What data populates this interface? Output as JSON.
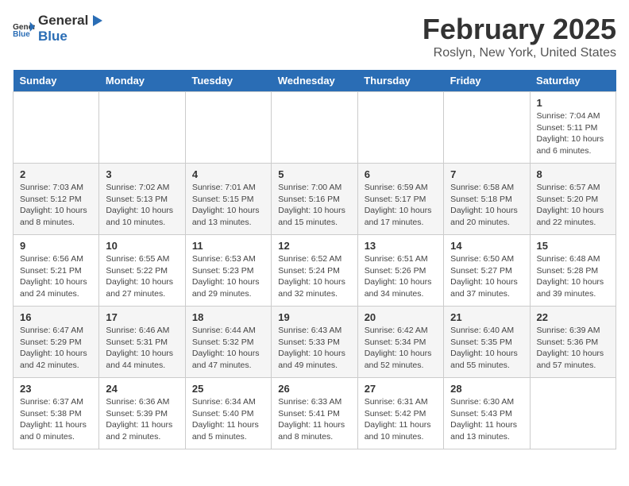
{
  "header": {
    "logo_general": "General",
    "logo_blue": "Blue",
    "title": "February 2025",
    "subtitle": "Roslyn, New York, United States"
  },
  "days_of_week": [
    "Sunday",
    "Monday",
    "Tuesday",
    "Wednesday",
    "Thursday",
    "Friday",
    "Saturday"
  ],
  "weeks": [
    [
      {
        "day": "",
        "info": ""
      },
      {
        "day": "",
        "info": ""
      },
      {
        "day": "",
        "info": ""
      },
      {
        "day": "",
        "info": ""
      },
      {
        "day": "",
        "info": ""
      },
      {
        "day": "",
        "info": ""
      },
      {
        "day": "1",
        "info": "Sunrise: 7:04 AM\nSunset: 5:11 PM\nDaylight: 10 hours and 6 minutes."
      }
    ],
    [
      {
        "day": "2",
        "info": "Sunrise: 7:03 AM\nSunset: 5:12 PM\nDaylight: 10 hours and 8 minutes."
      },
      {
        "day": "3",
        "info": "Sunrise: 7:02 AM\nSunset: 5:13 PM\nDaylight: 10 hours and 10 minutes."
      },
      {
        "day": "4",
        "info": "Sunrise: 7:01 AM\nSunset: 5:15 PM\nDaylight: 10 hours and 13 minutes."
      },
      {
        "day": "5",
        "info": "Sunrise: 7:00 AM\nSunset: 5:16 PM\nDaylight: 10 hours and 15 minutes."
      },
      {
        "day": "6",
        "info": "Sunrise: 6:59 AM\nSunset: 5:17 PM\nDaylight: 10 hours and 17 minutes."
      },
      {
        "day": "7",
        "info": "Sunrise: 6:58 AM\nSunset: 5:18 PM\nDaylight: 10 hours and 20 minutes."
      },
      {
        "day": "8",
        "info": "Sunrise: 6:57 AM\nSunset: 5:20 PM\nDaylight: 10 hours and 22 minutes."
      }
    ],
    [
      {
        "day": "9",
        "info": "Sunrise: 6:56 AM\nSunset: 5:21 PM\nDaylight: 10 hours and 24 minutes."
      },
      {
        "day": "10",
        "info": "Sunrise: 6:55 AM\nSunset: 5:22 PM\nDaylight: 10 hours and 27 minutes."
      },
      {
        "day": "11",
        "info": "Sunrise: 6:53 AM\nSunset: 5:23 PM\nDaylight: 10 hours and 29 minutes."
      },
      {
        "day": "12",
        "info": "Sunrise: 6:52 AM\nSunset: 5:24 PM\nDaylight: 10 hours and 32 minutes."
      },
      {
        "day": "13",
        "info": "Sunrise: 6:51 AM\nSunset: 5:26 PM\nDaylight: 10 hours and 34 minutes."
      },
      {
        "day": "14",
        "info": "Sunrise: 6:50 AM\nSunset: 5:27 PM\nDaylight: 10 hours and 37 minutes."
      },
      {
        "day": "15",
        "info": "Sunrise: 6:48 AM\nSunset: 5:28 PM\nDaylight: 10 hours and 39 minutes."
      }
    ],
    [
      {
        "day": "16",
        "info": "Sunrise: 6:47 AM\nSunset: 5:29 PM\nDaylight: 10 hours and 42 minutes."
      },
      {
        "day": "17",
        "info": "Sunrise: 6:46 AM\nSunset: 5:31 PM\nDaylight: 10 hours and 44 minutes."
      },
      {
        "day": "18",
        "info": "Sunrise: 6:44 AM\nSunset: 5:32 PM\nDaylight: 10 hours and 47 minutes."
      },
      {
        "day": "19",
        "info": "Sunrise: 6:43 AM\nSunset: 5:33 PM\nDaylight: 10 hours and 49 minutes."
      },
      {
        "day": "20",
        "info": "Sunrise: 6:42 AM\nSunset: 5:34 PM\nDaylight: 10 hours and 52 minutes."
      },
      {
        "day": "21",
        "info": "Sunrise: 6:40 AM\nSunset: 5:35 PM\nDaylight: 10 hours and 55 minutes."
      },
      {
        "day": "22",
        "info": "Sunrise: 6:39 AM\nSunset: 5:36 PM\nDaylight: 10 hours and 57 minutes."
      }
    ],
    [
      {
        "day": "23",
        "info": "Sunrise: 6:37 AM\nSunset: 5:38 PM\nDaylight: 11 hours and 0 minutes."
      },
      {
        "day": "24",
        "info": "Sunrise: 6:36 AM\nSunset: 5:39 PM\nDaylight: 11 hours and 2 minutes."
      },
      {
        "day": "25",
        "info": "Sunrise: 6:34 AM\nSunset: 5:40 PM\nDaylight: 11 hours and 5 minutes."
      },
      {
        "day": "26",
        "info": "Sunrise: 6:33 AM\nSunset: 5:41 PM\nDaylight: 11 hours and 8 minutes."
      },
      {
        "day": "27",
        "info": "Sunrise: 6:31 AM\nSunset: 5:42 PM\nDaylight: 11 hours and 10 minutes."
      },
      {
        "day": "28",
        "info": "Sunrise: 6:30 AM\nSunset: 5:43 PM\nDaylight: 11 hours and 13 minutes."
      },
      {
        "day": "",
        "info": ""
      }
    ]
  ]
}
